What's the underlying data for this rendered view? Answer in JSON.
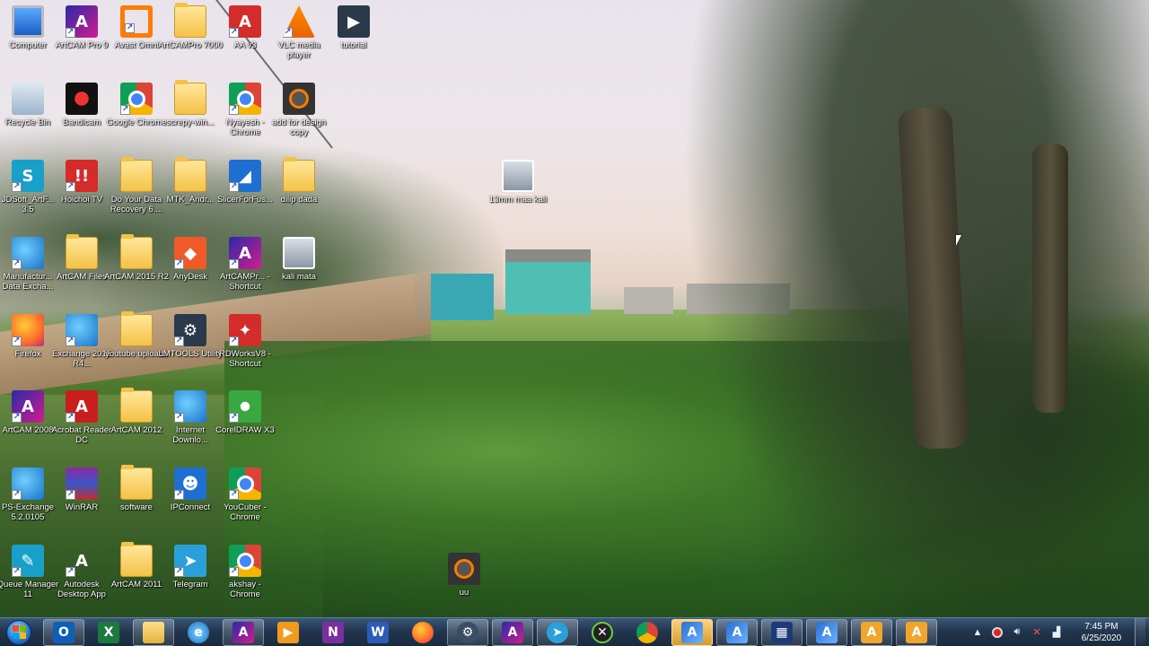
{
  "desktop": {
    "icons": [
      {
        "id": "computer",
        "label": "Computer",
        "icon": "computer-icon",
        "style": "monitor",
        "glyph": "",
        "shortcut": false
      },
      {
        "id": "artcam-pro-9",
        "label": "ArtCAM Pro 9",
        "icon": "artcam-icon",
        "style": "artcam",
        "glyph": "A",
        "shortcut": true
      },
      {
        "id": "avast-omni",
        "label": "Avast Omni",
        "icon": "avast-icon",
        "style": "avast",
        "glyph": "",
        "shortcut": true
      },
      {
        "id": "artcampro-7000",
        "label": "ArtCAMPro 7000",
        "icon": "folder-icon",
        "style": "folder",
        "glyph": "",
        "shortcut": false
      },
      {
        "id": "aa-v3",
        "label": "AA v3",
        "icon": "red-a-icon",
        "style": "red",
        "glyph": "A",
        "shortcut": true
      },
      {
        "id": "vlc",
        "label": "VLC media player",
        "icon": "vlc-cone-icon",
        "style": "vlc",
        "glyph": "",
        "shortcut": true
      },
      {
        "id": "tutorial",
        "label": "tutorial",
        "icon": "file-icon",
        "style": "dark",
        "glyph": "▶",
        "shortcut": false
      },
      {
        "id": "recycle-bin",
        "label": "Recycle Bin",
        "icon": "recycle-bin-icon",
        "style": "recycle",
        "glyph": "",
        "shortcut": false
      },
      {
        "id": "bandicam",
        "label": "Bandicam",
        "icon": "bandicam-icon",
        "style": "bandicam",
        "glyph": "",
        "shortcut": false
      },
      {
        "id": "google-chrome",
        "label": "Google Chrome",
        "icon": "chrome-icon",
        "style": "chrome",
        "glyph": "",
        "shortcut": true
      },
      {
        "id": "screpy-win",
        "label": "screpy-win...",
        "icon": "folder-icon",
        "style": "folder",
        "glyph": "",
        "shortcut": false
      },
      {
        "id": "nyayesh-chrome",
        "label": "Nyayesh - Chrome",
        "icon": "chrome-icon",
        "style": "chrome",
        "glyph": "",
        "shortcut": true
      },
      {
        "id": "add-for-design",
        "label": "add for design copy",
        "icon": "camera-icon",
        "style": "cam",
        "glyph": "",
        "shortcut": false
      },
      {
        "id": "jdsoft",
        "label": "JDSoft_ArtF... 3.5",
        "icon": "jdsoft-icon",
        "style": "teal",
        "glyph": "S",
        "shortcut": true
      },
      {
        "id": "hoichoi",
        "label": "Hoichoi TV",
        "icon": "hoichoi-icon",
        "style": "red",
        "glyph": "!!",
        "shortcut": true
      },
      {
        "id": "do-your-data",
        "label": "Do Your Data Recovery 6....",
        "icon": "folder-icon",
        "style": "folder",
        "glyph": "",
        "shortcut": false
      },
      {
        "id": "mtk-andr",
        "label": "MTK_Andr...",
        "icon": "folder-icon",
        "style": "folder",
        "glyph": "",
        "shortcut": false
      },
      {
        "id": "slicerforfus",
        "label": "SlicerForFus...",
        "icon": "slicer-icon",
        "style": "blue",
        "glyph": "◢",
        "shortcut": true
      },
      {
        "id": "dilip-dada",
        "label": "dilip dada",
        "icon": "folder-icon",
        "style": "folder",
        "glyph": "",
        "shortcut": false
      },
      {
        "id": "manufactur",
        "label": "Manufactur... Data Excha...",
        "icon": "globe-icon",
        "style": "ie",
        "glyph": "",
        "shortcut": true
      },
      {
        "id": "artcam-files",
        "label": "ArtCAM Files",
        "icon": "folder-icon",
        "style": "folder",
        "glyph": "",
        "shortcut": false
      },
      {
        "id": "artcam-2015",
        "label": "ArtCAM 2015 R2",
        "icon": "folder-icon",
        "style": "folder",
        "glyph": "",
        "shortcut": false
      },
      {
        "id": "anydesk",
        "label": "AnyDesk",
        "icon": "anydesk-icon",
        "style": "orange",
        "glyph": "◆",
        "shortcut": true
      },
      {
        "id": "artcampr-shortcut",
        "label": "ArtCAMPr... - Shortcut",
        "icon": "artcam-icon",
        "style": "artcam",
        "glyph": "A",
        "shortcut": true
      },
      {
        "id": "kali-mata",
        "label": "kali mata",
        "icon": "image-icon",
        "style": "photo",
        "glyph": "",
        "shortcut": false
      },
      {
        "id": "firefox",
        "label": "Firefox",
        "icon": "firefox-icon",
        "style": "firefox",
        "glyph": "",
        "shortcut": true
      },
      {
        "id": "exchange-2015",
        "label": "Exchange 2015 R4...",
        "icon": "globe-icon",
        "style": "ie",
        "glyph": "",
        "shortcut": true
      },
      {
        "id": "youtube-uploads",
        "label": "youtube uploads",
        "icon": "folder-icon",
        "style": "folder",
        "glyph": "",
        "shortcut": false
      },
      {
        "id": "lmtools",
        "label": "LMTOOLS Utility",
        "icon": "lmtools-icon",
        "style": "dark",
        "glyph": "⚙",
        "shortcut": true
      },
      {
        "id": "rdworks",
        "label": "RDWorksV8 - Shortcut",
        "icon": "rdworks-icon",
        "style": "red",
        "glyph": "✦",
        "shortcut": true
      },
      {
        "id": "artcam-2008",
        "label": "ArtCAM 2008",
        "icon": "artcam-icon",
        "style": "artcam",
        "glyph": "A",
        "shortcut": true
      },
      {
        "id": "acrobat",
        "label": "Acrobat Reader DC",
        "icon": "acrobat-icon",
        "style": "acro",
        "glyph": "A",
        "shortcut": true
      },
      {
        "id": "artcam-2012",
        "label": "ArtCAM 2012",
        "icon": "folder-icon",
        "style": "folder",
        "glyph": "",
        "shortcut": false
      },
      {
        "id": "internet-download",
        "label": "Internet Downlo...",
        "icon": "globe-icon",
        "style": "ie",
        "glyph": "",
        "shortcut": true
      },
      {
        "id": "coreldraw",
        "label": "CorelDRAW X3",
        "icon": "coreldraw-icon",
        "style": "cdr",
        "glyph": "",
        "shortcut": true
      },
      {
        "id": "ps-exchange",
        "label": "PS-Exchange 5.2.0105",
        "icon": "globe-icon",
        "style": "ie",
        "glyph": "",
        "shortcut": true
      },
      {
        "id": "winrar",
        "label": "WinRAR",
        "icon": "winrar-icon",
        "style": "winrar",
        "glyph": "",
        "shortcut": true
      },
      {
        "id": "software",
        "label": "software",
        "icon": "folder-icon",
        "style": "folder",
        "glyph": "",
        "shortcut": false
      },
      {
        "id": "ipconnect",
        "label": "IPConnect",
        "icon": "user-icon",
        "style": "blue",
        "glyph": "☻",
        "shortcut": true
      },
      {
        "id": "youcuber",
        "label": "YouCuber - Chrome",
        "icon": "chrome-icon",
        "style": "chrome",
        "glyph": "",
        "shortcut": true
      },
      {
        "id": "queue-manager",
        "label": "Queue Manager 11",
        "icon": "queue-icon",
        "style": "teal",
        "glyph": "✎",
        "shortcut": true
      },
      {
        "id": "autodesk",
        "label": "Autodesk Desktop App",
        "icon": "autodesk-icon",
        "style": "autodesk",
        "glyph": "A",
        "shortcut": true
      },
      {
        "id": "artcam-2011",
        "label": "ArtCAM 2011",
        "icon": "folder-icon",
        "style": "folder",
        "glyph": "",
        "shortcut": false
      },
      {
        "id": "telegram",
        "label": "Telegram",
        "icon": "telegram-icon",
        "style": "tele",
        "glyph": "➤",
        "shortcut": true
      },
      {
        "id": "akshay-chrome",
        "label": "akshay - Chrome",
        "icon": "chrome-icon",
        "style": "chrome",
        "glyph": "",
        "shortcut": true
      },
      {
        "id": "13mm-maa-kali",
        "label": "13mm maa kali",
        "icon": "image-icon",
        "style": "photo",
        "glyph": "",
        "shortcut": false
      },
      {
        "id": "uu",
        "label": "uu",
        "icon": "camera-icon",
        "style": "cam",
        "glyph": "",
        "shortcut": false
      }
    ]
  },
  "taskbar": {
    "pinned": [
      {
        "id": "outlook",
        "icon": "outlook-icon",
        "glyph": "O",
        "style": "g-outlook",
        "active": true,
        "highlight": false
      },
      {
        "id": "excel",
        "icon": "excel-icon",
        "glyph": "X",
        "style": "g-excel",
        "active": false,
        "highlight": false
      },
      {
        "id": "explorer",
        "icon": "folder-icon",
        "glyph": "",
        "style": "g-files",
        "active": true,
        "highlight": false
      },
      {
        "id": "ie",
        "icon": "ie-icon",
        "glyph": "e",
        "style": "g-ie",
        "active": false,
        "highlight": false
      },
      {
        "id": "artcam",
        "icon": "artcam-icon",
        "glyph": "A",
        "style": "g-artcam",
        "active": true,
        "highlight": false
      },
      {
        "id": "media",
        "icon": "media-player-icon",
        "glyph": "▶",
        "style": "g-media",
        "active": false,
        "highlight": false
      },
      {
        "id": "onenote",
        "icon": "onenote-icon",
        "glyph": "N",
        "style": "g-onenote",
        "active": false,
        "highlight": false
      },
      {
        "id": "word",
        "icon": "word-icon",
        "glyph": "W",
        "style": "g-word",
        "active": false,
        "highlight": false
      },
      {
        "id": "firefox",
        "icon": "firefox-icon",
        "glyph": "",
        "style": "g-ff",
        "active": false,
        "highlight": false
      },
      {
        "id": "tool",
        "icon": "tool-icon",
        "glyph": "⚙",
        "style": "g-tool",
        "active": true,
        "highlight": false
      },
      {
        "id": "artcam2",
        "icon": "artcam-icon",
        "glyph": "A",
        "style": "g-artcam",
        "active": true,
        "highlight": false
      },
      {
        "id": "telegram",
        "icon": "telegram-icon",
        "glyph": "➤",
        "style": "g-tele",
        "active": true,
        "highlight": false
      },
      {
        "id": "xbox",
        "icon": "xbox-icon",
        "glyph": "✕",
        "style": "g-xbox",
        "active": false,
        "highlight": false
      },
      {
        "id": "chrome",
        "icon": "chrome-icon",
        "glyph": "",
        "style": "g-chrome",
        "active": false,
        "highlight": false
      },
      {
        "id": "artcam-a1",
        "icon": "artcam-a-icon",
        "glyph": "A",
        "style": "g-artA",
        "active": false,
        "highlight": true
      },
      {
        "id": "artcam-a2",
        "icon": "artcam-a-icon",
        "glyph": "A",
        "style": "g-artA",
        "active": true,
        "highlight": false
      },
      {
        "id": "data-tool",
        "icon": "data-tool-icon",
        "glyph": "▦",
        "style": "g-dt",
        "active": true,
        "highlight": false
      },
      {
        "id": "artcam-a3",
        "icon": "artcam-a-icon",
        "glyph": "A",
        "style": "g-artA",
        "active": true,
        "highlight": false
      },
      {
        "id": "orange-a1",
        "icon": "orange-a-icon",
        "glyph": "A",
        "style": "g-orangeA",
        "active": true,
        "highlight": false
      },
      {
        "id": "orange-a2",
        "icon": "orange-a-icon",
        "glyph": "A",
        "style": "g-orangeA",
        "active": true,
        "highlight": false
      }
    ],
    "tray": {
      "icons": [
        "chevron-up-icon",
        "record-icon",
        "volume-icon",
        "network-icon",
        "signal-icon"
      ],
      "time": "7:45 PM",
      "date": "6/25/2020"
    }
  }
}
